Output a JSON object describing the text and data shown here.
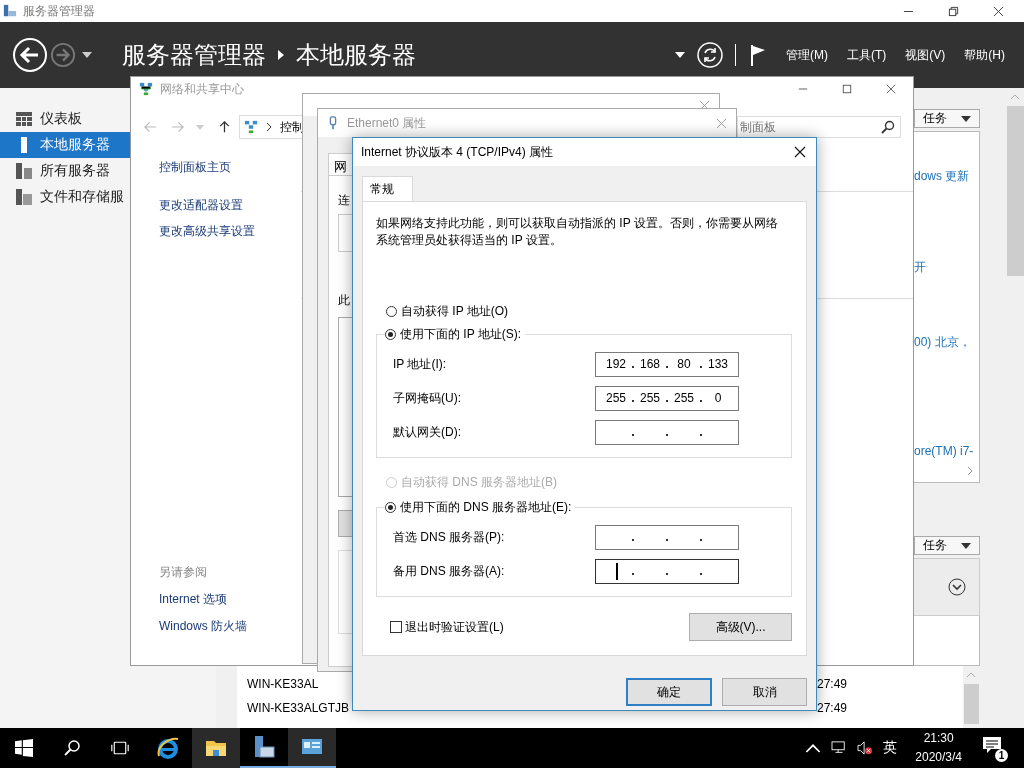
{
  "app_window": {
    "title": "服务器管理器",
    "breadcrumb": [
      "服务器管理器",
      "本地服务器"
    ],
    "menus": [
      "管理(M)",
      "工具(T)",
      "视图(V)",
      "帮助(H)"
    ]
  },
  "sidebar": {
    "items": [
      {
        "label": "仪表板",
        "selected": false
      },
      {
        "label": "本地服务器",
        "selected": true
      },
      {
        "label": "所有服务器",
        "selected": false
      },
      {
        "label": "文件和存储服",
        "selected": false
      }
    ]
  },
  "content": {
    "task_buttons": [
      "任务",
      "任务"
    ],
    "properties_fragments": [
      "dows 更新",
      "开",
      "00) 北京，",
      "ore(TM) i7-"
    ],
    "event_rows": [
      {
        "server": "WIN-KE33AL",
        "time": "27:49"
      },
      {
        "server": "WIN-KE33ALGTJB",
        "time": "27:49"
      }
    ]
  },
  "network_center": {
    "title": "网络和共享中心",
    "address": "控制",
    "search": {
      "placeholder": "制面板"
    },
    "links": [
      "控制面板主页",
      "更改适配器设置",
      "更改高级共享设置"
    ],
    "see_also": {
      "heading": "另请参阅",
      "links": [
        "Internet 选项",
        "Windows 防火墙"
      ]
    }
  },
  "ethernet_properties": {
    "title": "Ethernet0 属性",
    "tab": "网",
    "labels": [
      "连",
      "此"
    ]
  },
  "ipv4_dialog": {
    "title": "Internet 协议版本 4 (TCP/IPv4) 属性",
    "tabs": [
      {
        "label": "常规",
        "selected": true
      }
    ],
    "description": "如果网络支持此功能，则可以获取自动指派的 IP 设置。否则，你需要从网络系统管理员处获得适当的 IP 设置。",
    "ip_mode": [
      {
        "label": "自动获得 IP 地址(O)",
        "selected": false,
        "disabled": false
      },
      {
        "label": "使用下面的 IP 地址(S):",
        "selected": true,
        "disabled": false
      }
    ],
    "ip_fields": [
      {
        "label": "IP 地址(I):",
        "octets": [
          "192",
          "168",
          "80",
          "133"
        ]
      },
      {
        "label": "子网掩码(U):",
        "octets": [
          "255",
          "255",
          "255",
          "0"
        ]
      },
      {
        "label": "默认网关(D):"
      }
    ],
    "dns_mode": [
      {
        "label": "自动获得 DNS 服务器地址(B)",
        "selected": false,
        "disabled": true
      },
      {
        "label": "使用下面的 DNS 服务器地址(E):",
        "selected": true,
        "disabled": false
      }
    ],
    "dns_fields": [
      {
        "label": "首选 DNS 服务器(P):",
        "focused": false
      },
      {
        "label": "备用 DNS 服务器(A):",
        "focused": true
      }
    ],
    "validate_on_exit": {
      "label": "退出时验证设置(L)",
      "checked": false
    },
    "buttons": {
      "advanced": "高级(V)...",
      "ok": "确定",
      "cancel": "取消"
    }
  },
  "taskbar": {
    "apps": [
      {
        "kind": "ie",
        "highlighted": false,
        "running": false
      },
      {
        "kind": "explorer",
        "highlighted": true,
        "running": false
      },
      {
        "kind": "server-manager",
        "highlighted": false,
        "running": true
      },
      {
        "kind": "network",
        "highlighted": true,
        "running": true
      }
    ],
    "tray": {
      "ime": "英",
      "time": "21:30",
      "date": "2020/3/4",
      "notifications": "1"
    }
  }
}
